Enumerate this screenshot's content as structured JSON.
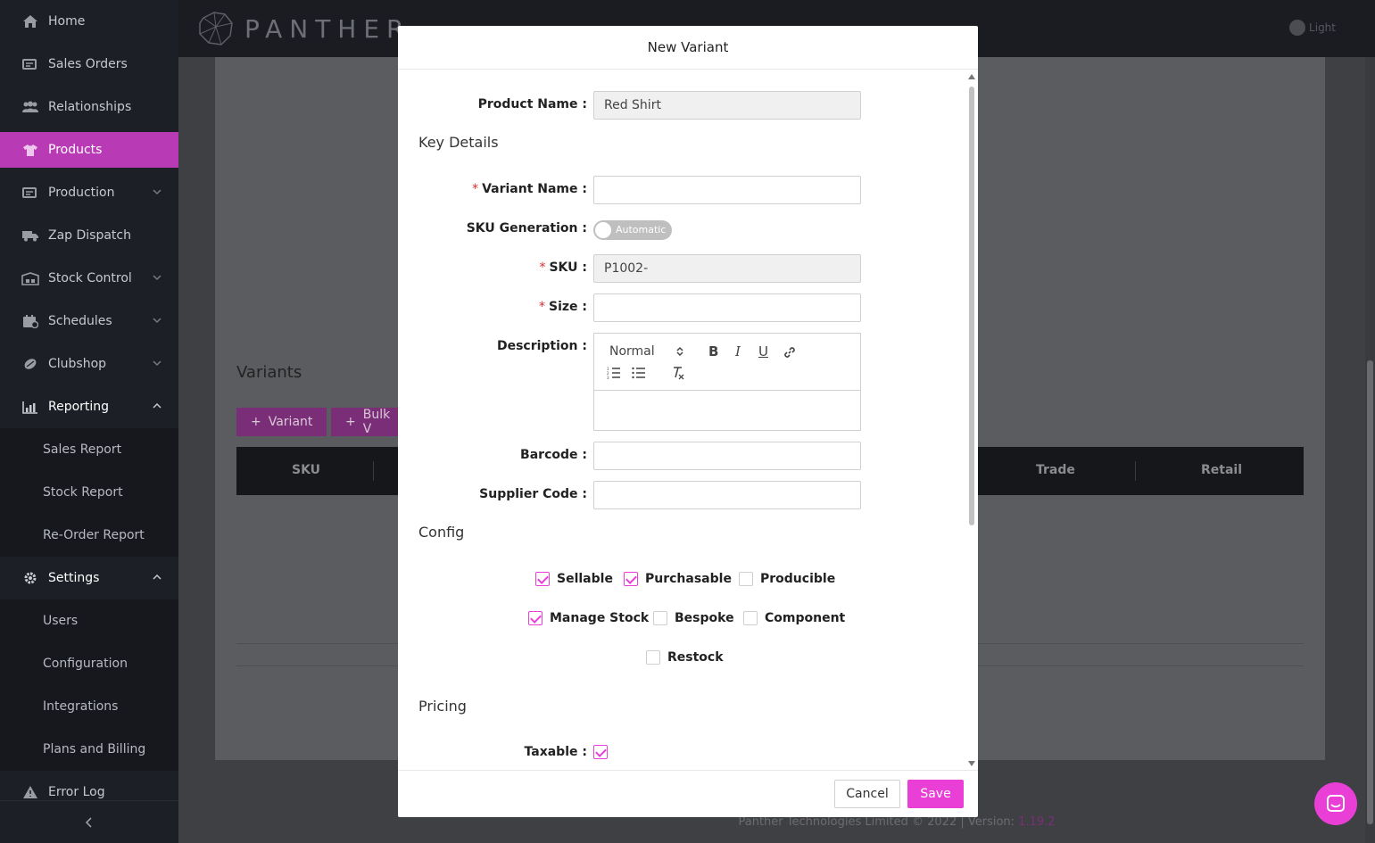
{
  "sidebar": {
    "items": [
      {
        "label": "Home",
        "icon": "home-icon"
      },
      {
        "label": "Sales Orders",
        "icon": "sales-orders-icon"
      },
      {
        "label": "Relationships",
        "icon": "users-icon"
      },
      {
        "label": "Products",
        "icon": "shirt-icon"
      },
      {
        "label": "Production",
        "icon": "production-icon"
      },
      {
        "label": "Zap Dispatch",
        "icon": "truck-icon"
      },
      {
        "label": "Stock Control",
        "icon": "warehouse-icon"
      },
      {
        "label": "Schedules",
        "icon": "calendar-icon"
      },
      {
        "label": "Clubshop",
        "icon": "ball-icon"
      },
      {
        "label": "Reporting",
        "icon": "chart-icon"
      },
      {
        "label": "Settings",
        "icon": "gear-icon"
      },
      {
        "label": "Error Log",
        "icon": "warning-icon"
      }
    ],
    "reporting_sub": [
      "Sales Report",
      "Stock Report",
      "Re-Order Report"
    ],
    "settings_sub": [
      "Users",
      "Configuration",
      "Integrations",
      "Plans and Billing"
    ]
  },
  "topbar": {
    "brand": "PANTHER",
    "theme_label": "Light"
  },
  "main": {
    "variants_title": "Variants",
    "add_variant_label": "Variant",
    "bulk_label": "Bulk V",
    "table_headers": {
      "sku": "SKU",
      "trade": "Trade",
      "retail": "Retail"
    },
    "footer_text": "Panther Technologies Limited © 2022 | Version: ",
    "footer_version": "1.19.2"
  },
  "modal": {
    "title": "New Variant",
    "product_name_label": "Product Name",
    "product_name_value": "Red Shirt",
    "key_details_title": "Key Details",
    "variant_name_label": "Variant Name",
    "variant_name_value": "",
    "sku_generation_label": "SKU Generation",
    "sku_generation_value": "Automatic",
    "sku_label": "SKU",
    "sku_value": "P1002-",
    "size_label": "Size",
    "size_value": "",
    "description_label": "Description",
    "editor_format": "Normal",
    "barcode_label": "Barcode",
    "supplier_code_label": "Supplier Code",
    "config_title": "Config",
    "config": {
      "sellable": {
        "label": "Sellable",
        "checked": true
      },
      "purchasable": {
        "label": "Purchasable",
        "checked": true
      },
      "producible": {
        "label": "Producible",
        "checked": false
      },
      "manage_stock": {
        "label": "Manage Stock",
        "checked": true
      },
      "bespoke": {
        "label": "Bespoke",
        "checked": false
      },
      "component": {
        "label": "Component",
        "checked": false
      },
      "restock": {
        "label": "Restock",
        "checked": false
      }
    },
    "pricing_title": "Pricing",
    "taxable_label": "Taxable",
    "taxable_checked": true,
    "cancel_label": "Cancel",
    "save_label": "Save"
  },
  "colors": {
    "accent": "#e93fd7",
    "sidebar_active": "#b93ab5",
    "sidebar_bg": "#1d1f26"
  }
}
